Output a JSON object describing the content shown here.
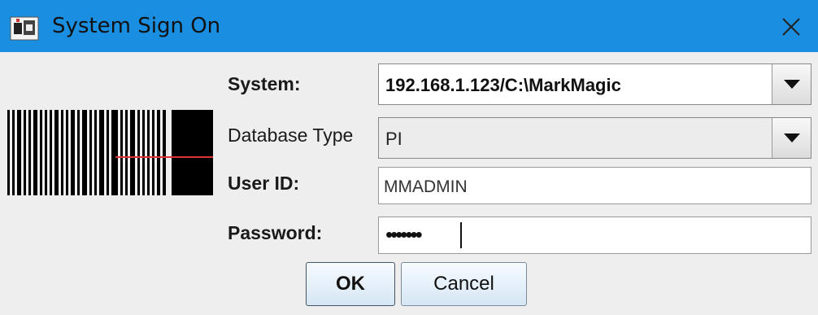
{
  "window": {
    "title": "System Sign On",
    "app_icon": "markmagic-app-icon",
    "close_icon": "close-icon",
    "titlebar_color": "#1a8ee0"
  },
  "form": {
    "system": {
      "label": "System:",
      "value": "192.168.1.123/C:\\MarkMagic"
    },
    "database_type": {
      "label": "Database Type",
      "value": "PI"
    },
    "user_id": {
      "label": "User ID:",
      "value": "MMADMIN"
    },
    "password": {
      "label": "Password:",
      "value": "•••••••"
    }
  },
  "buttons": {
    "ok": "OK",
    "cancel": "Cancel"
  },
  "decoration": {
    "barcode_icon": "barcode-image"
  }
}
